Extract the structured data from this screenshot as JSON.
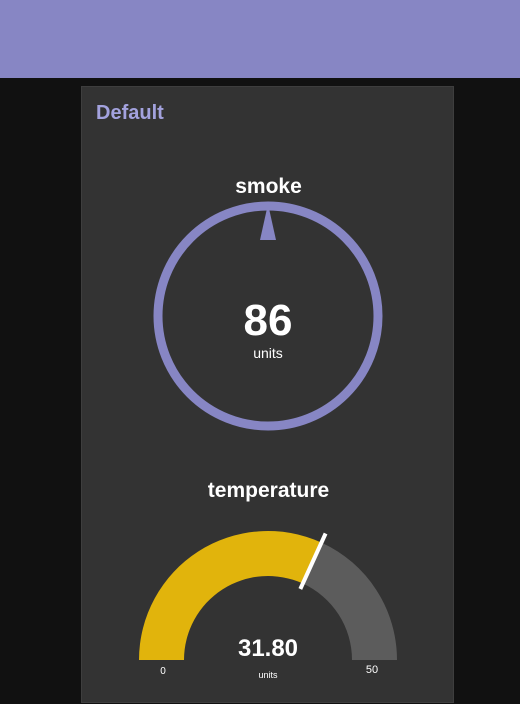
{
  "header": {
    "color": "#8786c4"
  },
  "group": {
    "title": "Default"
  },
  "gauges": {
    "smoke": {
      "title": "smoke",
      "value": "86",
      "units": "units",
      "type": "donut",
      "color": "#8786c4"
    },
    "temperature": {
      "title": "temperature",
      "value": "31.80",
      "units": "units",
      "min": "0",
      "max": "50",
      "fill_fraction": 0.636,
      "fill_color": "#e1b40c",
      "track_color": "#5c5c5c",
      "needle_color": "#ffffff"
    }
  }
}
